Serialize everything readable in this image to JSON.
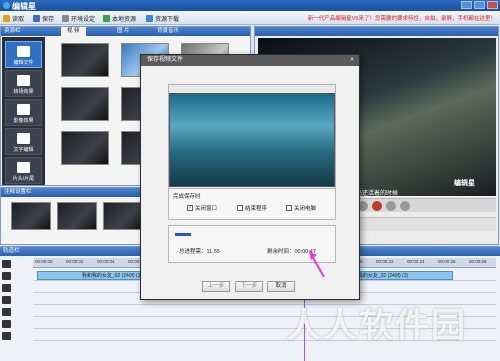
{
  "app": {
    "logo_text": "编辑星"
  },
  "toolbar": {
    "items": [
      {
        "label": "读取"
      },
      {
        "label": "保存"
      },
      {
        "label": "环境设定"
      },
      {
        "label": "本地资源"
      },
      {
        "label": "资源下载"
      }
    ],
    "notice": "新一代产品编辑星V6来了！您需要的要求特性，自拍，录屏，手机都在这里！"
  },
  "resource_panel": {
    "header": "资源栏",
    "tabs": [
      "视 频",
      "图 片",
      "背景音乐"
    ],
    "side_buttons": [
      "编辑文件",
      "转场效果",
      "影像效果",
      "文字编辑",
      "片头/片尾"
    ]
  },
  "subtitle_panel": {
    "header": "注释设置栏"
  },
  "preview": {
    "subtitle": "我们的奶还活着的时候",
    "logo": "编辑星"
  },
  "timeline": {
    "header": "轨道栏",
    "ticks": [
      "00:00:00",
      "00:00:02",
      "00:00:04",
      "00:00:06",
      "00:00:08",
      "00:00:10",
      "00:00:12",
      "00:00:14",
      "00:00:16",
      "00:00:18",
      "00:00:20",
      "00:00:22",
      "00:00:24",
      "00:00:26",
      "00:00:28"
    ],
    "clips": [
      "我和我的女友_02 (240f) (3)",
      "我和我的女友_02 (240f) (3)"
    ]
  },
  "modal": {
    "title": "保存视频文件",
    "close_symbol": "×",
    "after_complete_label": "完成保存时",
    "options": [
      {
        "label": "关闭窗口",
        "checked": true
      },
      {
        "label": "结束程序",
        "checked": false
      },
      {
        "label": "关闭电脑",
        "checked": false
      }
    ],
    "progress_fraction": 0.1,
    "total_time_label": "总进程需：11.55",
    "remaining_label": "剩余时间：00:00:47",
    "buttons": {
      "prev": "上一步",
      "next": "下一步",
      "cancel": "取消"
    }
  },
  "watermark": "人人软件园",
  "colors": {
    "accent": "#2b5fab",
    "notice": "#e32020",
    "arrow": "#e83cd8"
  }
}
